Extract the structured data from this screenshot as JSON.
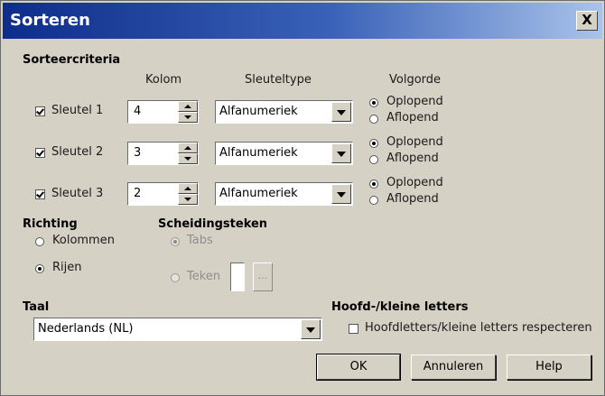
{
  "window": {
    "title": "Sorteren",
    "close_label": "X"
  },
  "criteria": {
    "heading": "Sorteercriteria",
    "col_kolom": "Kolom",
    "col_sleuteltype": "Sleuteltype",
    "col_volgorde": "Volgorde",
    "rows": [
      {
        "key_label": "Sleutel 1",
        "checked": true,
        "column": "4",
        "type": "Alfanumeriek",
        "asc_label": "Oplopend",
        "desc_label": "Aflopend",
        "order": "asc"
      },
      {
        "key_label": "Sleutel 2",
        "checked": true,
        "column": "3",
        "type": "Alfanumeriek",
        "asc_label": "Oplopend",
        "desc_label": "Aflopend",
        "order": "asc"
      },
      {
        "key_label": "Sleutel 3",
        "checked": true,
        "column": "2",
        "type": "Alfanumeriek",
        "asc_label": "Oplopend",
        "desc_label": "Aflopend",
        "order": "asc"
      }
    ]
  },
  "direction": {
    "heading": "Richting",
    "columns_label": "Kolommen",
    "rows_label": "Rijen",
    "selected": "rows"
  },
  "separator": {
    "heading": "Scheidingsteken",
    "tabs_label": "Tabs",
    "char_label": "Teken",
    "char_value": "",
    "browse_label": "...",
    "selected": "tabs",
    "disabled": true
  },
  "language": {
    "heading": "Taal",
    "value": "Nederlands (NL)"
  },
  "case": {
    "heading": "Hoofd-/kleine letters",
    "checkbox_label": "Hoofdletters/kleine letters respecteren",
    "checked": false
  },
  "buttons": {
    "ok": "OK",
    "cancel": "Annuleren",
    "help": "Help"
  },
  "icons": {
    "close": "close-icon",
    "spin_up": "arrow-up-icon",
    "spin_down": "arrow-down-icon",
    "dropdown": "chevron-down-icon"
  }
}
